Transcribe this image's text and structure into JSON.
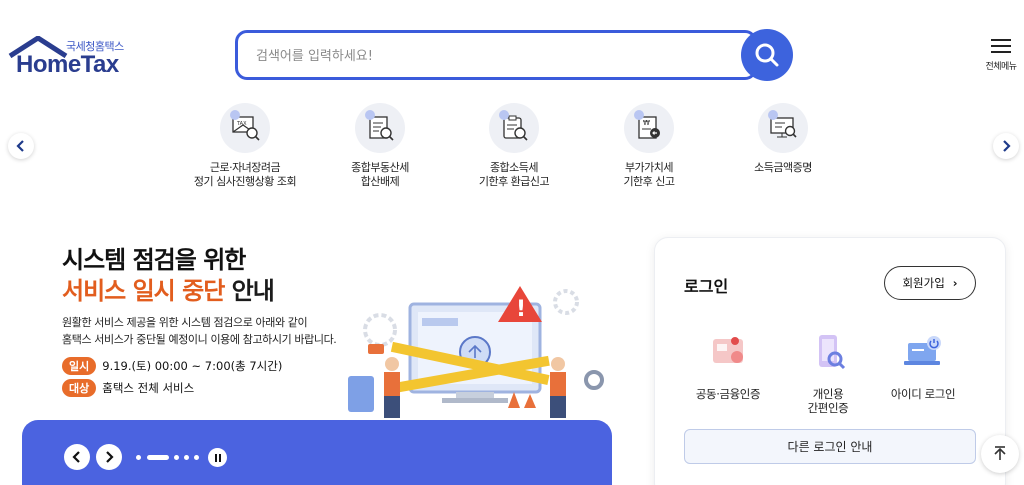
{
  "header": {
    "logo_sub": "국세청홈택스",
    "logo_main": "HomeTax",
    "search_placeholder": "검색어를 입력하세요!",
    "menu_label": "전체메뉴"
  },
  "quick_menu": {
    "items": [
      {
        "label": "근로·자녀장려금\n정기 심사진행상황 조회",
        "icon": "tax-document-magnifier-icon"
      },
      {
        "label": "종합부동산세\n합산배제",
        "icon": "document-magnifier-icon"
      },
      {
        "label": "종합소득세\n기한후 환급신고",
        "icon": "clipboard-magnifier-icon"
      },
      {
        "label": "부가가치세\n기한후 신고",
        "icon": "won-document-icon"
      },
      {
        "label": "소득금액증명",
        "icon": "monitor-magnifier-icon"
      }
    ]
  },
  "banner": {
    "title_line1": "시스템 점검을 위한",
    "title_line2_accent": "서비스 일시 중단",
    "title_line2_rest": " 안내",
    "desc_line1": "원활한 서비스 제공을 위한 시스템 점검으로 아래와 같이",
    "desc_line2": "홈택스 서비스가 중단될 예정이니 이용에 참고하시기 바랍니다.",
    "time_tag": "일시",
    "time_value": "9.19.(토) 00:00 ~ 7:00(총 7시간)",
    "target_tag": "대상",
    "target_value": "홈택스 전체 서비스"
  },
  "login": {
    "title": "로그인",
    "signup_label": "회원가입",
    "options": [
      {
        "label": "공동·금융인증",
        "icon": "certificate-card-icon"
      },
      {
        "label": "개인용\n간편인증",
        "icon": "phone-auth-icon"
      },
      {
        "label": "아이디 로그인",
        "icon": "id-laptop-icon"
      }
    ],
    "other_login_label": "다른 로그인 안내"
  },
  "colors": {
    "primary": "#3d63dd",
    "accent": "#e25d1e",
    "banner_bar": "#4b63e0"
  }
}
